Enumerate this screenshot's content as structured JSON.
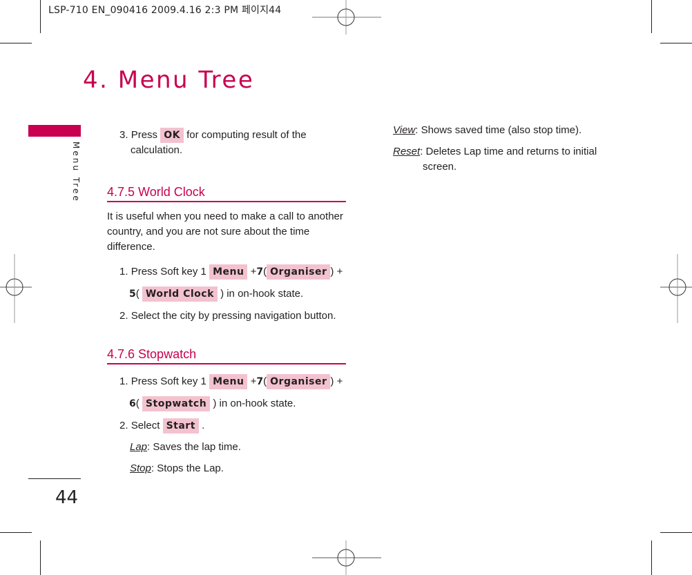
{
  "print_header": "LSP-710 EN_090416  2009.4.16 2:3 PM  페이지44",
  "chapter": {
    "title": "4. Menu Tree",
    "side_label": "Menu Tree",
    "page_number": "44"
  },
  "accent_color": "#c8004f",
  "key_highlight_color": "#f3c2cf",
  "intro_step": {
    "number": "3.",
    "before": "Press",
    "key": "OK",
    "after": "for computing result of the",
    "continuation": "calculation."
  },
  "world_clock": {
    "heading": "4.7.5 World Clock",
    "description_lines": [
      "It is useful when you need to make a call to another",
      "country, and you are not sure about the time",
      "difference."
    ],
    "step1": {
      "number": "1.",
      "text": "Press Soft key 1",
      "key_menu": "Menu",
      "plus1": "+",
      "digit1": "7",
      "key_organiser": "Organiser",
      "plus2": ") +",
      "digit2": "5",
      "key_item": "World Clock",
      "after": ") in on-hook state."
    },
    "step2": {
      "number": "2.",
      "text": "Select the city by pressing navigation button."
    }
  },
  "stopwatch": {
    "heading": "4.7.6 Stopwatch",
    "step1": {
      "number": "1.",
      "text": "Press Soft key 1",
      "key_menu": "Menu",
      "plus1": "+",
      "digit1": "7",
      "key_organiser": "Organiser",
      "plus2": ") +",
      "digit2": "6",
      "key_item": "Stopwatch",
      "after": ") in on-hook state."
    },
    "step2": {
      "number": "2.",
      "text": "Select",
      "key": "Start",
      "after": "."
    },
    "options": [
      {
        "term": "Lap",
        "desc": ": Saves the lap time."
      },
      {
        "term": "Stop",
        "desc": ": Stops the Lap."
      },
      {
        "term": "View",
        "desc": ": Shows saved time (also stop time)."
      },
      {
        "term": "Reset",
        "desc": ": Deletes Lap time and returns to initial",
        "continuation": "screen."
      }
    ]
  }
}
